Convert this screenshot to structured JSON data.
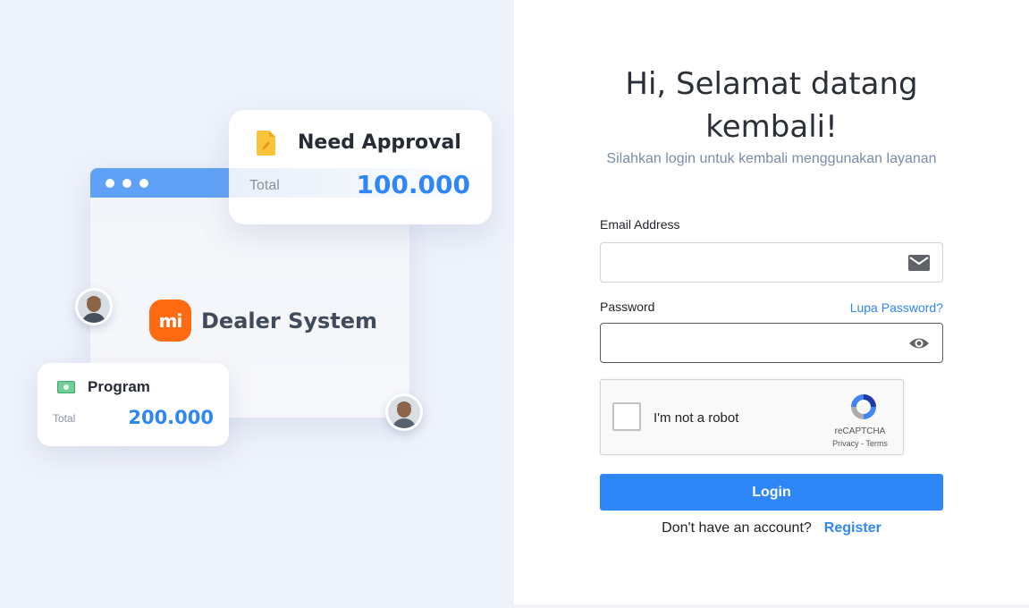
{
  "illustration": {
    "approval_card": {
      "title": "Need Approval",
      "label": "Total",
      "value": "100.000"
    },
    "brand": {
      "logo_text": "mi",
      "name": "Dealer System"
    },
    "program_card": {
      "title": "Program",
      "label": "Total",
      "value": "200.000"
    }
  },
  "login": {
    "heading_line1": "Hi, Selamat datang",
    "heading_line2": "kembali!",
    "subtitle": "Silahkan login untuk kembali menggunakan layanan",
    "email_label": "Email Address",
    "email_value": "",
    "password_label": "Password",
    "password_value": "",
    "forgot_link": "Lupa Password?",
    "captcha": {
      "text": "I'm not a robot",
      "brand": "reCAPTCHA",
      "links": "Privacy - Terms"
    },
    "login_button": "Login",
    "signup_prompt": "Don't have an account?",
    "register_link": "Register"
  },
  "colors": {
    "accent": "#2f86f6",
    "brand_orange": "#ff6a13",
    "left_panel_bg": "#eef2fb"
  },
  "icons": [
    "document-pen-icon",
    "money-bill-icon",
    "mail-icon",
    "eye-icon",
    "recaptcha-logo-icon",
    "avatar-icon"
  ]
}
